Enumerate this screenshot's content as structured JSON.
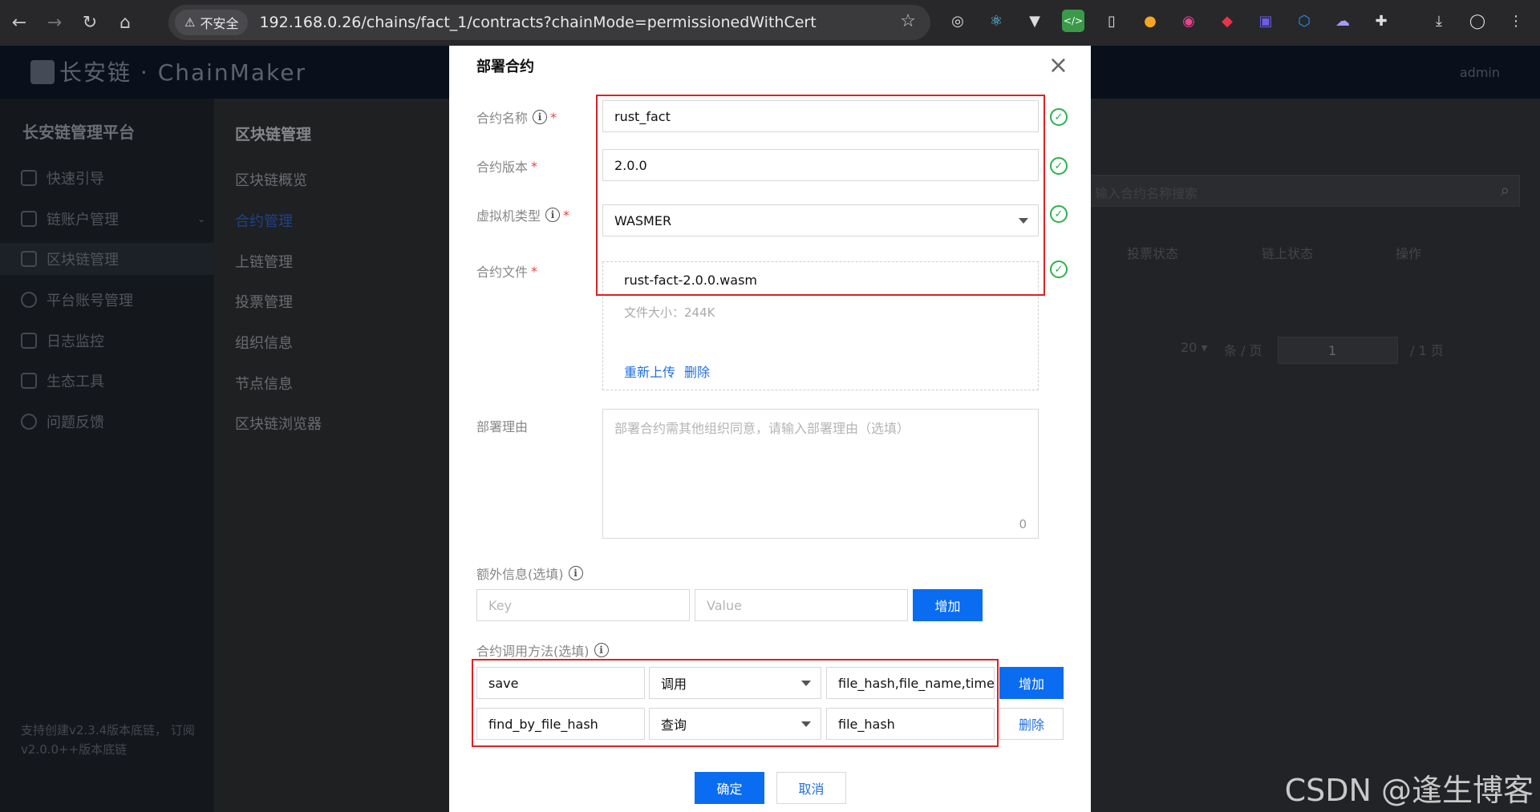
{
  "browser": {
    "security_label": "不安全",
    "url": "192.168.0.26/chains/fact_1/contracts?chainMode=permissionedWithCert"
  },
  "app": {
    "logo_text": "长安链 · ChainMaker",
    "user": "admin",
    "sidebar_title": "长安链管理平台",
    "sidebar_items": [
      "快速引导",
      "链账户管理",
      "区块链管理",
      "平台账号管理",
      "日志监控",
      "生态工具",
      "问题反馈"
    ],
    "sidebar_note": "支持创建v2.3.4版本底链， 订阅v2.0.0++版本底链",
    "submenu_title": "区块链管理",
    "submenu_items": [
      "区块链概览",
      "合约管理",
      "上链管理",
      "投票管理",
      "组织信息",
      "节点信息",
      "区块链浏览器"
    ],
    "search_placeholder": "输入合约名称搜索",
    "table_headers": [
      "投票状态",
      "链上状态",
      "操作"
    ],
    "pager_size": "20",
    "pager_unit": "条 / 页",
    "pager_page": "1",
    "pager_total": "/ 1 页"
  },
  "modal": {
    "title": "部署合约",
    "contract_name_label": "合约名称",
    "contract_name_value": "rust_fact",
    "contract_version_label": "合约版本",
    "contract_version_value": "2.0.0",
    "vm_type_label": "虚拟机类型",
    "vm_type_value": "WASMER",
    "file_label": "合约文件",
    "file_name": "rust-fact-2.0.0.wasm",
    "file_size": "文件大小：244K",
    "reupload": "重新上传",
    "delete": "删除",
    "reason_label": "部署理由",
    "reason_placeholder": "部署合约需其他组织同意，请输入部署理由（选填）",
    "reason_count": "0",
    "extra_label": "额外信息(选填)",
    "key_placeholder": "Key",
    "value_placeholder": "Value",
    "add": "增加",
    "methods_label": "合约调用方法(选填)",
    "methods": [
      {
        "name": "save",
        "type": "调用",
        "params": "file_hash,file_name,time",
        "action": "增加"
      },
      {
        "name": "find_by_file_hash",
        "type": "查询",
        "params": "file_hash",
        "action": "删除"
      }
    ],
    "confirm": "确定",
    "cancel": "取消"
  },
  "watermark": "CSDN @逢生博客"
}
